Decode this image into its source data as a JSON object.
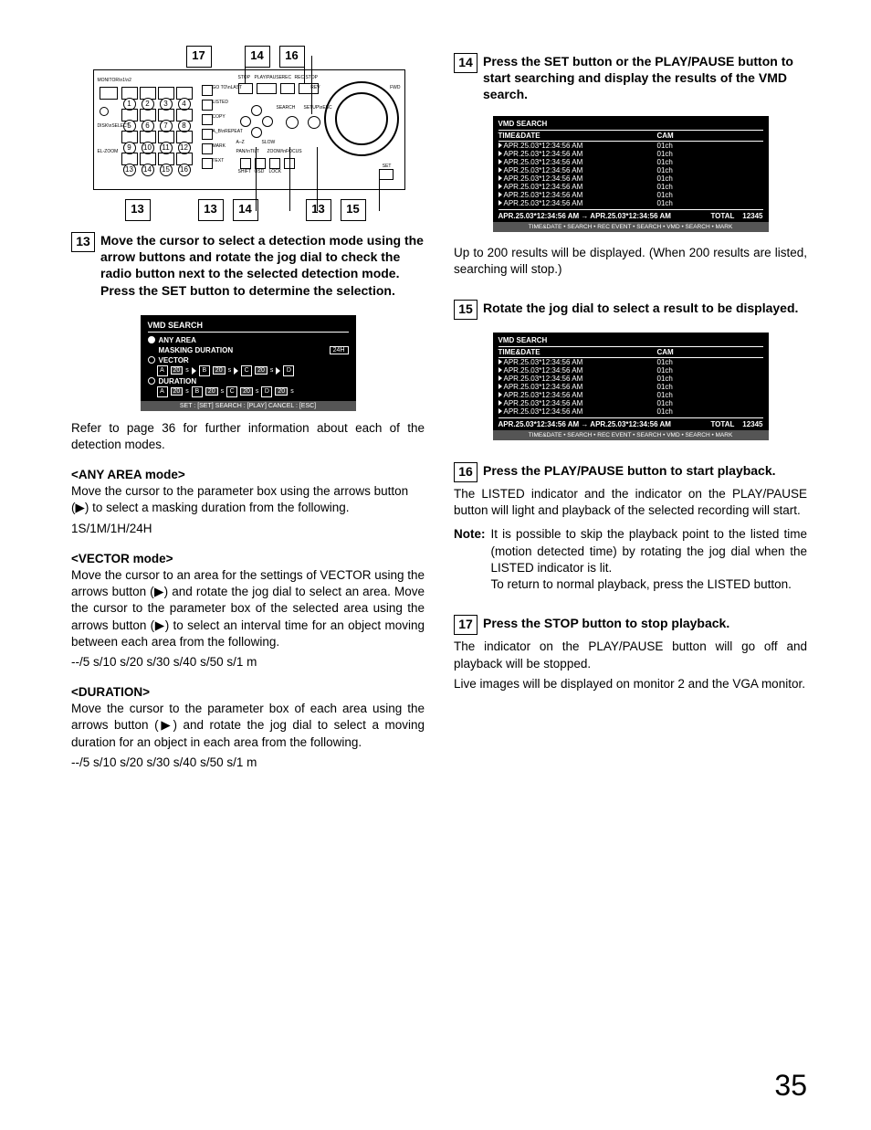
{
  "page_number": "35",
  "panel": {
    "top_labels": {
      "a": "17",
      "b": "14",
      "c": "16"
    },
    "bottom_labels": {
      "a": "13",
      "b1": "13",
      "b2": "14",
      "c1": "13",
      "c2": "15"
    },
    "pin_labels": {
      "stop": "STOP",
      "play": "PLAY/PAUSE",
      "rec": "REC",
      "rec_stop": "REC STOP",
      "rev": "REV",
      "fwd": "FWD",
      "search": "SEARCH",
      "setup": "SETUP\\nESC",
      "monitor": "MONITOR\\n1\\n2",
      "shift": "SHIFT",
      "osd": "OSD",
      "lock": "LOCK",
      "set": "SET",
      "pan": "PAN/\\nTILT",
      "zoom": "ZOOM/\\nFOCUS",
      "go": "GO TO\\nLAST",
      "listed": "LISTED",
      "copy": "COPY",
      "mark": "MARK",
      "text": "TEXT",
      "ab": "A_B\\nREPEAT",
      "az": "A–Z",
      "slow": "SLOW",
      "elzm": "EL-ZOOM",
      "disk": "DISK\\nSELECT"
    }
  },
  "step13": {
    "num": "13",
    "text": "Move the cursor to select a detection mode using the arrow buttons and rotate the jog dial to check the radio button next to the selected detection mode. Press the SET button to determine the selection."
  },
  "osd": {
    "title": "VMD SEARCH",
    "any_area": "ANY AREA",
    "masking": "MASKING DURATION",
    "mask_val": "24H",
    "vector": "VECTOR",
    "duration": "DURATION",
    "seg_labels": {
      "a": "A",
      "b": "B",
      "c": "C",
      "d": "D"
    },
    "seg_val": "20",
    "seg_unit": "s",
    "foot": "SET : [SET]    SEARCH : [PLAY]    CANCEL : [ESC]"
  },
  "refer": "Refer to page 36 for further information about each of the detection modes.",
  "any_area_h": "<ANY AREA mode>",
  "any_area_body_1": "Move the cursor to the parameter box using the arrows button (▶) to select a masking duration from the following.",
  "any_area_body_2": "1S/1M/1H/24H",
  "vector_h": "<VECTOR mode>",
  "vector_body_1": "Move the cursor to an area for the settings of VECTOR using the arrows button (▶) and rotate the jog dial to select an area. Move the cursor to the parameter box of the selected area using the arrows button (▶) to select an interval time for an object moving between each area from the following.",
  "vector_body_2": "--/5 s/10 s/20 s/30 s/40 s/50 s/1 m",
  "duration_h": "<DURATION>",
  "duration_body_1": "Move the cursor to the parameter box of each area using the arrows button (▶) and rotate the jog dial to select a moving duration for an object in each area from the following.",
  "duration_body_2": "--/5 s/10 s/20 s/30 s/40 s/50 s/1 m",
  "step14": {
    "num": "14",
    "text": "Press the SET button or the PLAY/PAUSE button to start searching and display the results of the VMD search."
  },
  "results": {
    "title": "VMD SEARCH",
    "th_time": "TIME&DATE",
    "th_cam": "CAM",
    "row_time": "APR.25.03*12:34:56 AM",
    "row_cam": "01ch",
    "range": "APR.25.03*12:34:56 AM → APR.25.03*12:34:56 AM",
    "total_l": "TOTAL",
    "total_v": "12345",
    "foot": "TIME&DATE • SEARCH • REC EVENT • SEARCH • VMD • SEARCH • MARK"
  },
  "upto": "Up to 200 results will be displayed. (When 200 results are listed, searching will stop.)",
  "step15": {
    "num": "15",
    "text": "Rotate the jog dial to select a result to be displayed."
  },
  "step16": {
    "num": "16",
    "text": "Press the PLAY/PAUSE button to start playback."
  },
  "s16_body": "The LISTED indicator and the indicator on the PLAY/PAUSE button will light and playback of the selected recording will start.",
  "note_l": "Note:",
  "note_1": "It is possible to skip the playback point to the listed time (motion detected time) by rotating the jog dial when the LISTED indicator is lit.",
  "note_2": "To return to normal playback, press the LISTED button.",
  "step17": {
    "num": "17",
    "text": "Press the STOP button to stop playback."
  },
  "s17_body_1": "The indicator on the PLAY/PAUSE button will go off and playback will be stopped.",
  "s17_body_2": "Live images will be displayed on monitor 2 and the VGA monitor."
}
